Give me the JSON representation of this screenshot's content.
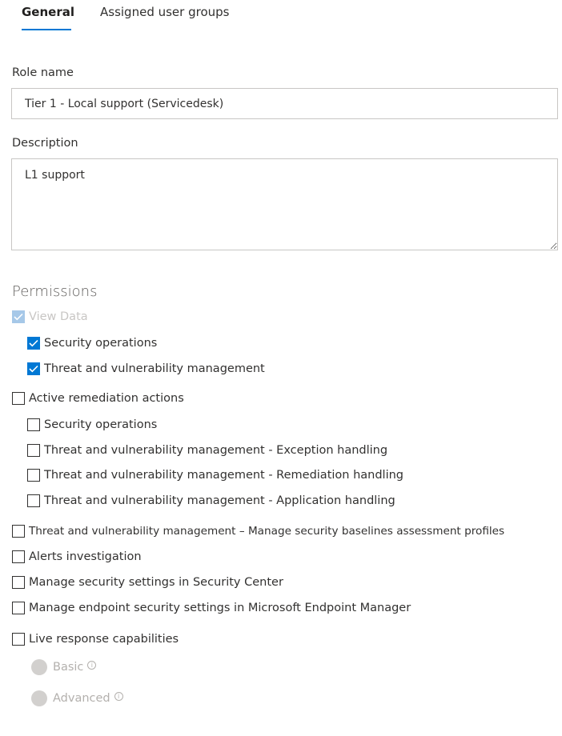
{
  "tabs": [
    {
      "label": "General",
      "active": true
    },
    {
      "label": "Assigned user groups",
      "active": false
    }
  ],
  "form": {
    "role_name_label": "Role name",
    "role_name_value": "Tier 1 - Local support (Servicedesk)",
    "description_label": "Description",
    "description_value": "L1 support"
  },
  "permissions": {
    "title": "Permissions",
    "view_data": {
      "label": "View Data",
      "checked": true,
      "disabled": true
    },
    "view_data_security_ops": {
      "label": "Security operations",
      "checked": true
    },
    "view_data_tvm": {
      "label": "Threat and vulnerability management",
      "checked": true
    },
    "active_remediation": {
      "label": "Active remediation actions",
      "checked": false
    },
    "remediation_security_ops": {
      "label": "Security operations",
      "checked": false
    },
    "tvm_exception": {
      "label": "Threat and vulnerability management - Exception handling",
      "checked": false
    },
    "tvm_remediation": {
      "label": "Threat and vulnerability management - Remediation handling",
      "checked": false
    },
    "tvm_application": {
      "label": "Threat and vulnerability management - Application handling",
      "checked": false
    },
    "tvm_baselines": {
      "label": "Threat and vulnerability management – Manage security baselines assessment profiles",
      "checked": false
    },
    "alerts_investigation": {
      "label": "Alerts investigation",
      "checked": false
    },
    "security_center_settings": {
      "label": "Manage security settings in Security Center",
      "checked": false
    },
    "endpoint_manager_settings": {
      "label": "Manage endpoint security settings in Microsoft Endpoint Manager",
      "checked": false
    },
    "live_response": {
      "label": "Live response capabilities",
      "checked": false
    },
    "live_response_options": [
      {
        "label": "Basic",
        "info_icon": "info-icon"
      },
      {
        "label": "Advanced",
        "info_icon": "info-icon"
      }
    ]
  },
  "colors": {
    "accent": "#0078d4",
    "border": "#c8c6c4",
    "disabled_text": "#c8c6c4"
  }
}
